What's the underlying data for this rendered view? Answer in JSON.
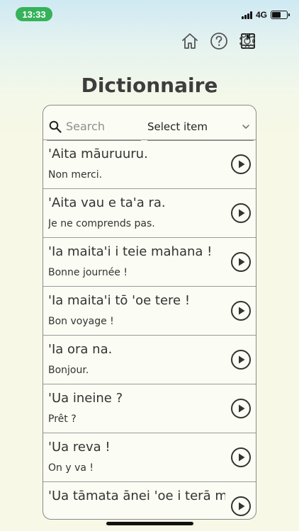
{
  "status_bar": {
    "time": "13:33",
    "network": "4G",
    "battery_level": 0.6
  },
  "toolbar": {
    "icons": [
      "home-icon",
      "help-icon",
      "dictionary-book-icon",
      "gear-icon"
    ]
  },
  "page": {
    "title": "Dictionnaire"
  },
  "filters": {
    "search_placeholder": "Search",
    "select_label": "Select item"
  },
  "entries": [
    {
      "tahitian": "'Aita māuruuru.",
      "french": "Non merci."
    },
    {
      "tahitian": "'Aita vau e ta'a ra.",
      "french": "Je ne comprends pas."
    },
    {
      "tahitian": "'Ia maita'i i teie mahana !",
      "french": "Bonne journée !"
    },
    {
      "tahitian": "'Ia maita'i tō 'oe tere !",
      "french": "Bon voyage !"
    },
    {
      "tahitian": "'Ia ora na.",
      "french": "Bonjour."
    },
    {
      "tahitian": "'Ua ineine ?",
      "french": "Prêt ?"
    },
    {
      "tahitian": "'Ua reva !",
      "french": "On y va !"
    },
    {
      "tahitian": "'Ua tāmata ānei 'oe i terā mā'a ?",
      "french": ""
    }
  ],
  "colors": {
    "time_pill": "#35b25a",
    "background": "#f7f8e6",
    "icon_stroke": "#555555"
  }
}
